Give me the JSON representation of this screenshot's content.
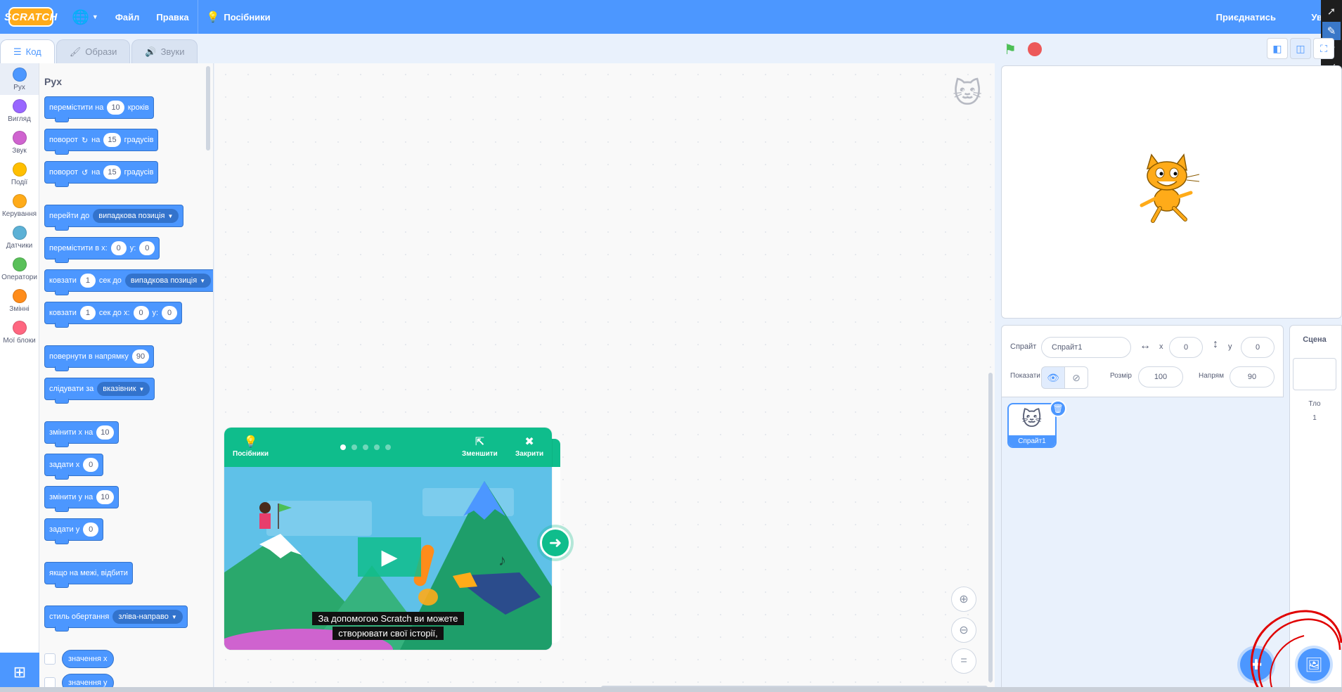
{
  "menubar": {
    "logo": "SCRATCH",
    "file": "Файл",
    "edit": "Правка",
    "tutorials": "Посібники",
    "join": "Приєднатись",
    "signin": "Ув"
  },
  "tabs": [
    {
      "label": "Код",
      "icon": "code-icon"
    },
    {
      "label": "Образи",
      "icon": "brush-icon"
    },
    {
      "label": "Звуки",
      "icon": "speaker-icon"
    }
  ],
  "categories": [
    {
      "label": "Рух",
      "color": "#4c97ff"
    },
    {
      "label": "Вигляд",
      "color": "#9966ff"
    },
    {
      "label": "Звук",
      "color": "#cf63cf"
    },
    {
      "label": "Події",
      "color": "#ffbf00"
    },
    {
      "label": "Керування",
      "color": "#ffab19"
    },
    {
      "label": "Датчики",
      "color": "#5cb1d6"
    },
    {
      "label": "Оператори",
      "color": "#59c059"
    },
    {
      "label": "Змінні",
      "color": "#ff8c1a"
    },
    {
      "label": "Мої блоки",
      "color": "#ff6680"
    }
  ],
  "palette": {
    "title": "Рух",
    "b1": {
      "t1": "перемістити на",
      "v1": "10",
      "t2": "кроків"
    },
    "b2": {
      "t1": "поворот",
      "t2": "на",
      "v1": "15",
      "t3": "градусів"
    },
    "b3": {
      "t1": "поворот",
      "t2": "на",
      "v1": "15",
      "t3": "градусів"
    },
    "b4": {
      "t1": "перейти до",
      "d1": "випадкова позиція"
    },
    "b5": {
      "t1": "перемістити в x:",
      "v1": "0",
      "t2": "y:",
      "v2": "0"
    },
    "b6": {
      "t1": "ковзати",
      "v1": "1",
      "t2": "сек до",
      "d1": "випадкова позиція"
    },
    "b7": {
      "t1": "ковзати",
      "v1": "1",
      "t2": "сек до x:",
      "v2": "0",
      "t3": "y:",
      "v3": "0"
    },
    "b8": {
      "t1": "повернути в напрямку",
      "v1": "90"
    },
    "b9": {
      "t1": "слідувати за",
      "d1": "вказівник"
    },
    "b10": {
      "t1": "змінити х на",
      "v1": "10"
    },
    "b11": {
      "t1": "задати х",
      "v1": "0"
    },
    "b12": {
      "t1": "змінити у на",
      "v1": "10"
    },
    "b13": {
      "t1": "задати у",
      "v1": "0"
    },
    "b14": {
      "t1": "якщо на межі, відбити"
    },
    "b15": {
      "t1": "стиль обертання",
      "d1": "зліва-направо"
    },
    "r1": "значення х",
    "r2": "значення у"
  },
  "tutorial": {
    "tutorials_label": "Посібники",
    "shrink_label": "Зменшити",
    "close_label": "Закрити",
    "dots": 5,
    "active_dot": 0,
    "subtitle_line1": "За допомогою Scratch ви можете",
    "subtitle_line2": "створювати свої історії,"
  },
  "sprite_info": {
    "sprite_label": "Спрайт",
    "sprite_name": "Спрайт1",
    "x_label": "x",
    "x_value": "0",
    "y_label": "y",
    "y_value": "0",
    "show_label": "Показати",
    "size_label": "Розмір",
    "size_value": "100",
    "direction_label": "Напрям",
    "direction_value": "90"
  },
  "sprites": [
    {
      "name": "Спрайт1"
    }
  ],
  "scene": {
    "title": "Сцена",
    "backdrops_label": "Тло",
    "backdrops_count": "1"
  },
  "colors": {
    "accent": "#4c97ff",
    "tutorial": "#0fbd8c",
    "annotation": "#ff0000"
  }
}
